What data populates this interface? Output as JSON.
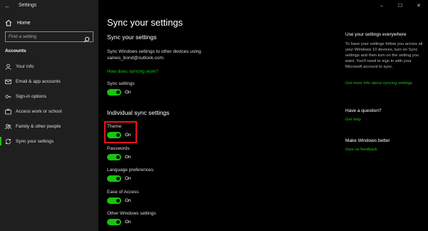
{
  "app": {
    "title": "Settings",
    "back_icon": "back-arrow-icon"
  },
  "window_controls": {
    "minimize": "–",
    "maximize": "☐",
    "close": "✕"
  },
  "sidebar": {
    "home_label": "Home",
    "search_placeholder": "Find a setting",
    "section_label": "Accounts",
    "items": [
      {
        "label": "Your info",
        "icon": "person-icon"
      },
      {
        "label": "Email & app accounts",
        "icon": "mail-icon"
      },
      {
        "label": "Sign-in options",
        "icon": "key-icon"
      },
      {
        "label": "Access work or school",
        "icon": "briefcase-icon"
      },
      {
        "label": "Family & other people",
        "icon": "people-icon"
      },
      {
        "label": "Sync your settings",
        "icon": "sync-icon",
        "active": true
      }
    ]
  },
  "main": {
    "title": "Sync your settings",
    "subtitle": "Sync your settings",
    "description": "Sync Windows settings to other devices using vames_bond@outlook.com.",
    "how_link": "How does syncing work?",
    "sync_settings": {
      "label": "Sync settings",
      "state": "On"
    },
    "individual_title": "Individual sync settings",
    "individual": [
      {
        "label": "Theme",
        "state": "On",
        "highlighted": true
      },
      {
        "label": "Passwords",
        "state": "On"
      },
      {
        "label": "Language preferences",
        "state": "On"
      },
      {
        "label": "Ease of Access",
        "state": "On"
      },
      {
        "label": "Other Windows settings",
        "state": "On"
      }
    ],
    "accent_color": "#16c60c",
    "highlight_color": "#e8141b"
  },
  "right": {
    "everywhere_title": "Use your settings everywhere",
    "everywhere_text": "To have your settings follow you across all your Windows 10 devices, turn on Sync settings and then turn on the setting you want. You'll need to sign in with your Microsoft account to sync.",
    "more_info_link": "Get more info about syncing settings",
    "question_title": "Have a question?",
    "help_link": "Get help",
    "better_title": "Make Windows better",
    "feedback_link": "Give us feedback"
  }
}
